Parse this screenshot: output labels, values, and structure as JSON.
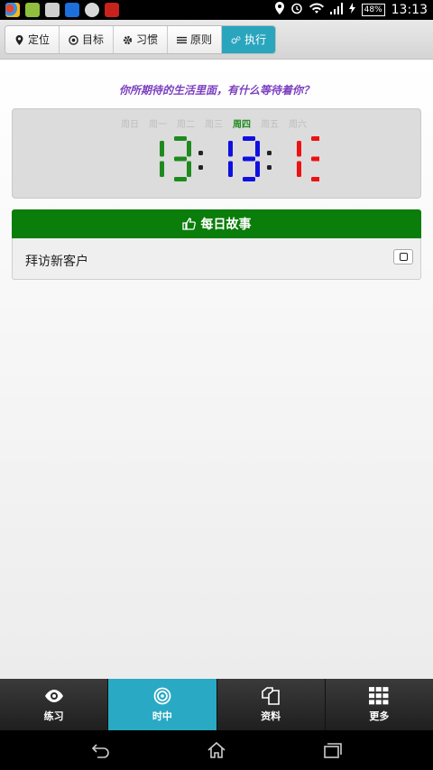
{
  "status_bar": {
    "battery": "48%",
    "time": "13:13"
  },
  "top_tabs": [
    {
      "label": "定位",
      "icon": "location-pin-icon",
      "active": false
    },
    {
      "label": "目标",
      "icon": "target-icon",
      "active": false
    },
    {
      "label": "习惯",
      "icon": "gear-icon",
      "active": false
    },
    {
      "label": "原则",
      "icon": "list-icon",
      "active": false
    },
    {
      "label": "执行",
      "icon": "cogs-icon",
      "active": true
    }
  ],
  "slogan": "你所期待的生活里面，有什么等待着你？",
  "weekdays": [
    "周日",
    "周一",
    "周二",
    "周三",
    "周四",
    "周五",
    "周六"
  ],
  "current_weekday": "周四",
  "clock": {
    "hours": "13",
    "minutes": "13",
    "seconds": "13",
    "colors": {
      "hours": "#1e8a1e",
      "minutes": "#1010e0",
      "seconds": "#ee1111"
    }
  },
  "story_button": {
    "label": "每日故事",
    "icon": "hand-pointer-icon"
  },
  "task": {
    "label": "拜访新客户",
    "checked": false
  },
  "bottom_nav": [
    {
      "label": "练习",
      "icon": "eye-icon",
      "active": false
    },
    {
      "label": "时中",
      "icon": "bullseye-icon",
      "active": true
    },
    {
      "label": "资料",
      "icon": "copy-icon",
      "active": false
    },
    {
      "label": "更多",
      "icon": "grid-icon",
      "active": false
    }
  ],
  "colors": {
    "accent": "#29a9c3",
    "story_green": "#0a7d0a",
    "slogan_purple": "#7b3fbf"
  }
}
